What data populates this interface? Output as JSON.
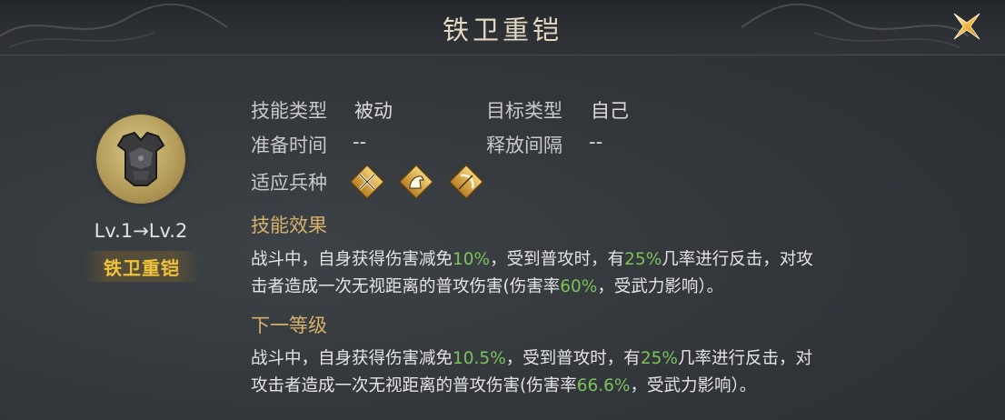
{
  "window": {
    "title": "铁卫重铠"
  },
  "skill": {
    "level_text": "Lv.1→Lv.2",
    "name": "铁卫重铠",
    "icon": "armor-icon"
  },
  "attributes": {
    "skill_type_label": "技能类型",
    "skill_type_value": "被动",
    "target_type_label": "目标类型",
    "target_type_value": "自己",
    "prep_time_label": "准备时间",
    "prep_time_value": "--",
    "cooldown_label": "释放间隔",
    "cooldown_value": "--",
    "troop_label": "适应兵种",
    "troops": [
      {
        "icon": "crossed-swords-icon"
      },
      {
        "icon": "horse-icon"
      },
      {
        "icon": "bow-icon"
      }
    ]
  },
  "effect": {
    "title": "技能效果",
    "p1": "战斗中，自身获得伤害减免",
    "v1": "10%",
    "p2": "，受到普攻时，有",
    "v2": "25%",
    "p3": "几率进行反击，对攻",
    "p4": "击者造成一次无视距离的普攻伤害(伤害率",
    "v3": "60%",
    "p5": "，受武力影响）。"
  },
  "next_level": {
    "title": "下一等级",
    "p1": "战斗中，自身获得伤害减免",
    "v1": "10.5%",
    "p2": "，受到普攻时，有",
    "v2": "25%",
    "p3": "几率进行反击，对",
    "p4": "攻击者造成一次无视距离的普攻伤害(伤害率",
    "v3": "66.6%",
    "p5": "，受武力影响）。"
  },
  "colors": {
    "accent_gold": "#f0c23a",
    "section_title": "#d6b06a",
    "highlight_green": "#7cc25a",
    "background": "#33373b"
  },
  "icons": {
    "close": "close-x-icon"
  }
}
